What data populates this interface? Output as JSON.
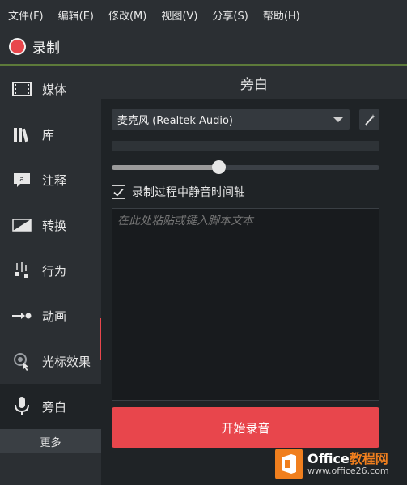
{
  "menubar": {
    "items": [
      "文件(F)",
      "编辑(E)",
      "修改(M)",
      "视图(V)",
      "分享(S)",
      "帮助(H)"
    ]
  },
  "record": {
    "label": "录制"
  },
  "sidebar": {
    "items": [
      {
        "label": "媒体",
        "icon": "film-icon"
      },
      {
        "label": "库",
        "icon": "library-icon"
      },
      {
        "label": "注释",
        "icon": "annotation-icon"
      },
      {
        "label": "转换",
        "icon": "transition-icon"
      },
      {
        "label": "行为",
        "icon": "behavior-icon"
      },
      {
        "label": "动画",
        "icon": "animation-icon"
      },
      {
        "label": "光标效果",
        "icon": "cursor-effect-icon"
      },
      {
        "label": "旁白",
        "icon": "microphone-icon"
      }
    ],
    "more_label": "更多",
    "active_index": 7
  },
  "panel": {
    "title": "旁白",
    "mic_device": "麦克风 (Realtek Audio)",
    "volume_level": 0.4,
    "mute_during_record": {
      "label": "录制过程中静音时间轴",
      "checked": true
    },
    "script_placeholder": "在此处粘贴或键入脚本文本",
    "start_button": "开始录音"
  },
  "watermark": {
    "title_white": "Office",
    "title_accent": "教程网",
    "url": "www.office26.com"
  },
  "colors": {
    "accent": "#e8464c",
    "sidebar_bg": "#2b2f33",
    "panel_bg": "#1f2326",
    "brand_orange": "#f07f1e"
  }
}
